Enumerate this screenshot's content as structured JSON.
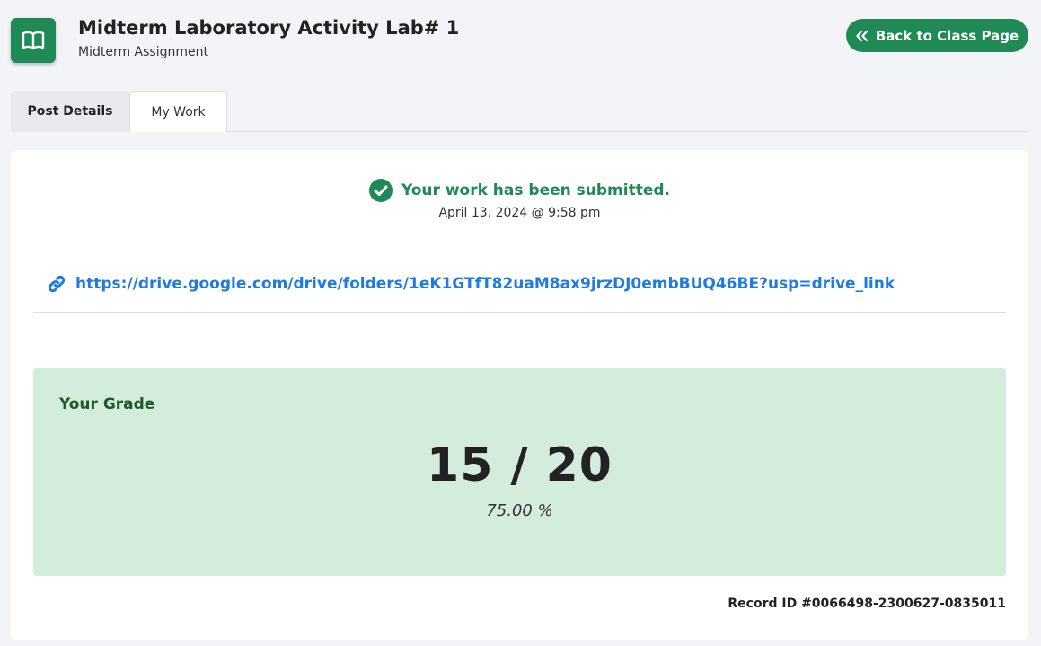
{
  "header": {
    "icon": "open-book-icon",
    "title": "Midterm Laboratory Activity Lab# 1",
    "subtitle": "Midterm Assignment",
    "back_button_label": "Back to Class Page",
    "back_button_icon": "double-chevron-left-icon"
  },
  "tabs": [
    {
      "label": "Post Details",
      "active": false
    },
    {
      "label": "My Work",
      "active": true
    }
  ],
  "submission": {
    "status_icon": "check-circle-icon",
    "status_text": "Your work has been submitted.",
    "timestamp": "April 13, 2024 @ 9:58 pm",
    "link_icon": "link-icon",
    "link_url": "https://drive.google.com/drive/folders/1eK1GTfT82uaM8ax9jrzDJ0embBUQ46BE?usp=drive_link"
  },
  "grade": {
    "label": "Your Grade",
    "score_display": "15 / 20",
    "percent_display": "75.00 %"
  },
  "record_id": "Record ID #0066498-2300627-0835011",
  "colors": {
    "brand_green": "#1f8a55",
    "link_blue": "#1e7be0",
    "grade_bg": "#d4ecdb"
  }
}
